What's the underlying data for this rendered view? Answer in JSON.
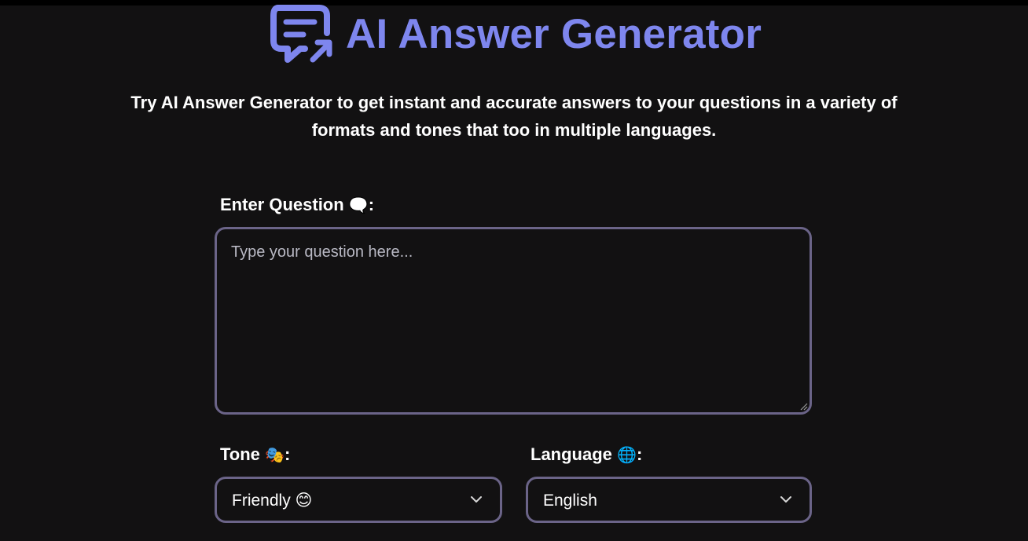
{
  "header": {
    "title": "AI Answer Generator",
    "icon": "chat-bubble-share-icon",
    "accent_color": "#7e86ee"
  },
  "subtitle": "Try AI Answer Generator to get instant and accurate answers to your questions in a variety of formats and tones that too in multiple languages.",
  "question": {
    "label": "Enter Question",
    "label_emoji": "🗨️",
    "label_suffix": ":",
    "placeholder": "Type your question here...",
    "value": ""
  },
  "tone": {
    "label": "Tone",
    "label_emoji": "🎭",
    "label_suffix": ":",
    "selected": "Friendly 😊",
    "icon": "chevron-down-icon"
  },
  "language": {
    "label": "Language",
    "label_emoji": "🌐",
    "label_suffix": ":",
    "selected": "English",
    "icon": "chevron-down-icon"
  },
  "colors": {
    "background": "#121112",
    "border": "#6b6488",
    "text": "#ffffff",
    "placeholder": "#b9b9c4"
  }
}
